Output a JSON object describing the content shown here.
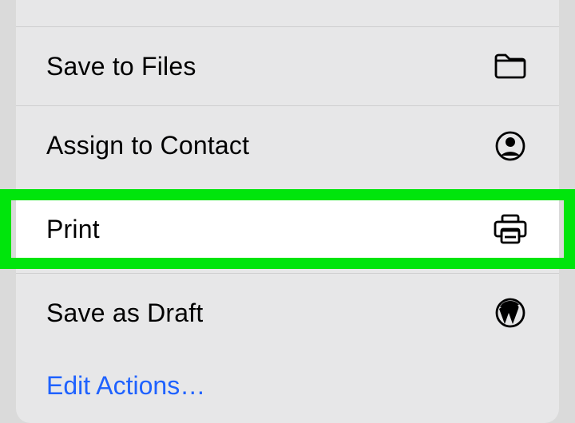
{
  "actions": {
    "save_to_files": {
      "label": "Save to Files",
      "icon": "folder-icon"
    },
    "assign_to_contact": {
      "label": "Assign to Contact",
      "icon": "contact-icon"
    },
    "print": {
      "label": "Print",
      "icon": "printer-icon"
    },
    "save_as_draft": {
      "label": "Save as Draft",
      "icon": "wordpress-icon"
    }
  },
  "footer": {
    "edit_actions_label": "Edit Actions…"
  }
}
